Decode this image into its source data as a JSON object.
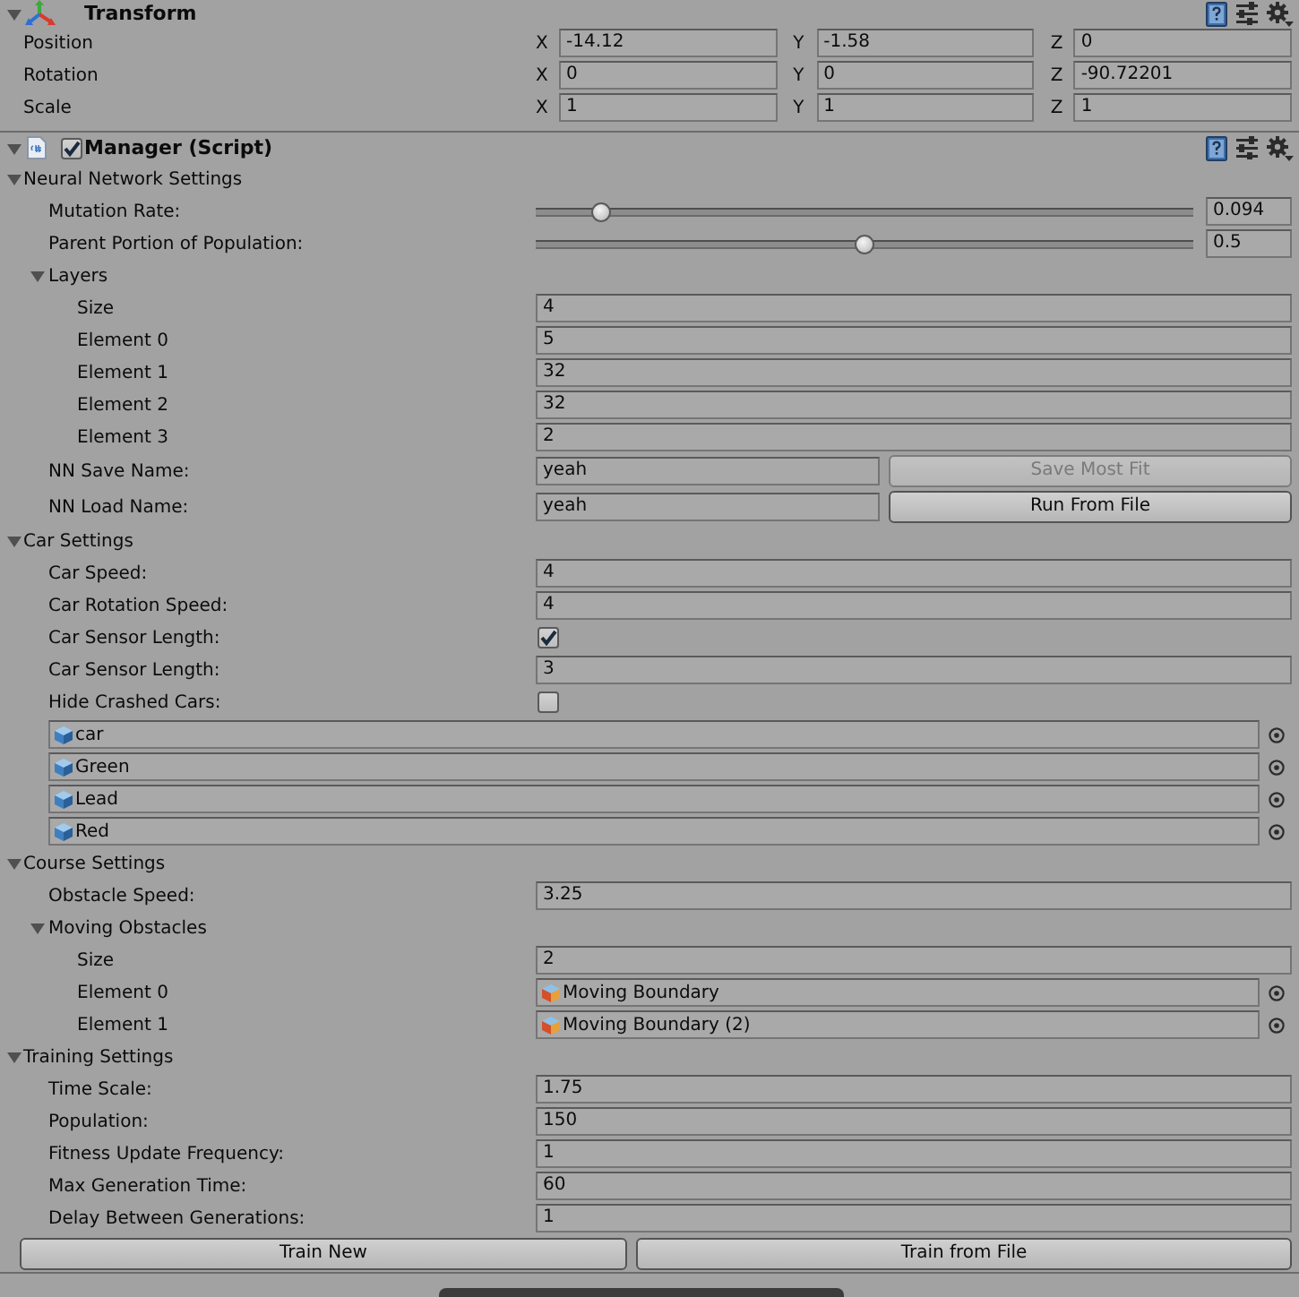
{
  "transform": {
    "title": "Transform",
    "expanded": true,
    "rows": [
      {
        "label": "Position",
        "axes": [
          {
            "axis": "X",
            "value": "-14.12"
          },
          {
            "axis": "Y",
            "value": "-1.58"
          },
          {
            "axis": "Z",
            "value": "0"
          }
        ]
      },
      {
        "label": "Rotation",
        "axes": [
          {
            "axis": "X",
            "value": "0"
          },
          {
            "axis": "Y",
            "value": "0"
          },
          {
            "axis": "Z",
            "value": "-90.72201"
          }
        ]
      },
      {
        "label": "Scale",
        "axes": [
          {
            "axis": "X",
            "value": "1"
          },
          {
            "axis": "Y",
            "value": "1"
          },
          {
            "axis": "Z",
            "value": "1"
          }
        ]
      }
    ]
  },
  "manager": {
    "title": "Manager (Script)",
    "expanded": true,
    "enabled": true,
    "sections": [
      {
        "title": "Neural Network Settings",
        "expanded": true,
        "fields": [
          {
            "kind": "slider",
            "label": "Mutation Rate:",
            "level": 0.1,
            "value": "0.094"
          },
          {
            "kind": "slider",
            "label": "Parent Portion of Population:",
            "level": 0.5,
            "value": "0.5"
          },
          {
            "kind": "foldout",
            "label": "Layers",
            "expanded": true,
            "children": [
              {
                "kind": "text",
                "label": "Size",
                "value": "4"
              },
              {
                "kind": "text",
                "label": "Element 0",
                "value": "5"
              },
              {
                "kind": "text",
                "label": "Element 1",
                "value": "32"
              },
              {
                "kind": "text",
                "label": "Element 2",
                "value": "32"
              },
              {
                "kind": "text",
                "label": "Element 3",
                "value": "2"
              }
            ]
          },
          {
            "kind": "action",
            "label": "NN Save Name:",
            "value": "yeah",
            "button": {
              "label": "Save Most Fit",
              "disabled": true
            }
          },
          {
            "kind": "action",
            "label": "NN Load Name:",
            "value": "yeah",
            "button": {
              "label": "Run From File",
              "disabled": false
            }
          }
        ]
      },
      {
        "title": "Car Settings",
        "expanded": true,
        "fields": [
          {
            "kind": "text",
            "label": "Car Speed:",
            "value": "4"
          },
          {
            "kind": "text",
            "label": "Car Rotation Speed:",
            "value": "4"
          },
          {
            "kind": "checkbox",
            "label": "Car Sensor Length:",
            "checked": true
          },
          {
            "kind": "text",
            "label": "Car Sensor Length:",
            "value": "3"
          },
          {
            "kind": "checkbox",
            "label": "Hide Crashed Cars:",
            "checked": false
          },
          {
            "kind": "object",
            "value": "car"
          },
          {
            "kind": "object",
            "value": "Green"
          },
          {
            "kind": "object",
            "value": "Lead"
          },
          {
            "kind": "object",
            "value": "Red"
          }
        ]
      },
      {
        "title": "Course Settings",
        "expanded": true,
        "fields": [
          {
            "kind": "text",
            "label": "Obstacle Speed:",
            "value": "3.25"
          },
          {
            "kind": "foldout",
            "label": "Moving Obstacles",
            "expanded": true,
            "children": [
              {
                "kind": "text",
                "label": "Size",
                "value": "2"
              },
              {
                "kind": "model",
                "label": "Element 0",
                "value": "Moving Boundary"
              },
              {
                "kind": "model",
                "label": "Element 1",
                "value": "Moving Boundary (2)"
              }
            ]
          }
        ]
      },
      {
        "title": "Training Settings",
        "expanded": true,
        "fields": [
          {
            "kind": "text",
            "label": "Time Scale:",
            "value": "1.75"
          },
          {
            "kind": "text",
            "label": "Population:",
            "value": "150"
          },
          {
            "kind": "text",
            "label": "Fitness Update Frequency:",
            "value": "1"
          },
          {
            "kind": "text",
            "label": "Max Generation Time:",
            "value": "60"
          },
          {
            "kind": "text",
            "label": "Delay Between Generations:",
            "value": "1"
          }
        ]
      }
    ]
  },
  "buttons": [
    {
      "label": "Train New"
    },
    {
      "label": "Train from File"
    }
  ]
}
